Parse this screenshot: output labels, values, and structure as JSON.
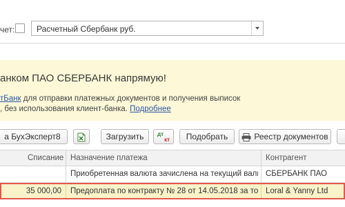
{
  "account": {
    "label": "чет:",
    "selected": "Расчетный Сбербанк руб."
  },
  "banner": {
    "title": "анком ПАО СБЕРБАНК напрямую!",
    "line1_link": "тБанк",
    "line1_rest": " для отправки платежных документов и получения выписок",
    "line2_text": ", без использования клиент-банка. ",
    "line2_link": "Подробнее"
  },
  "toolbar": {
    "buhexpert_label": "а БухЭксперт8",
    "upload_label": "Загрузить",
    "dtkt_top": "дт",
    "dtkt_bottom": "кт",
    "pick_label": "Подобрать",
    "registry_label": "Реестр документов"
  },
  "table": {
    "headers": {
      "debit": "Списание",
      "purpose": "Назначение платежа",
      "counterparty": "Контрагент"
    },
    "rows": [
      {
        "debit": "",
        "purpose": "Приобретенная валюта зачислена на текущий валют...",
        "counterparty": "СБЕРБАНК ПАО"
      },
      {
        "debit": "35 000,00",
        "purpose": "Предоплата по контракту № 28 от 14.05.2018 за това...",
        "counterparty": "Loral & Yanny Ltd"
      }
    ]
  },
  "colors": {
    "banner_bg": "#fdf8d7",
    "link": "#2b57a7",
    "selected_row_bg": "#faf3c9",
    "selected_row_border": "#e5574b"
  },
  "icons": {
    "excel": "excel-icon",
    "dtkt": "dtkt-icon",
    "printer": "printer-icon"
  }
}
